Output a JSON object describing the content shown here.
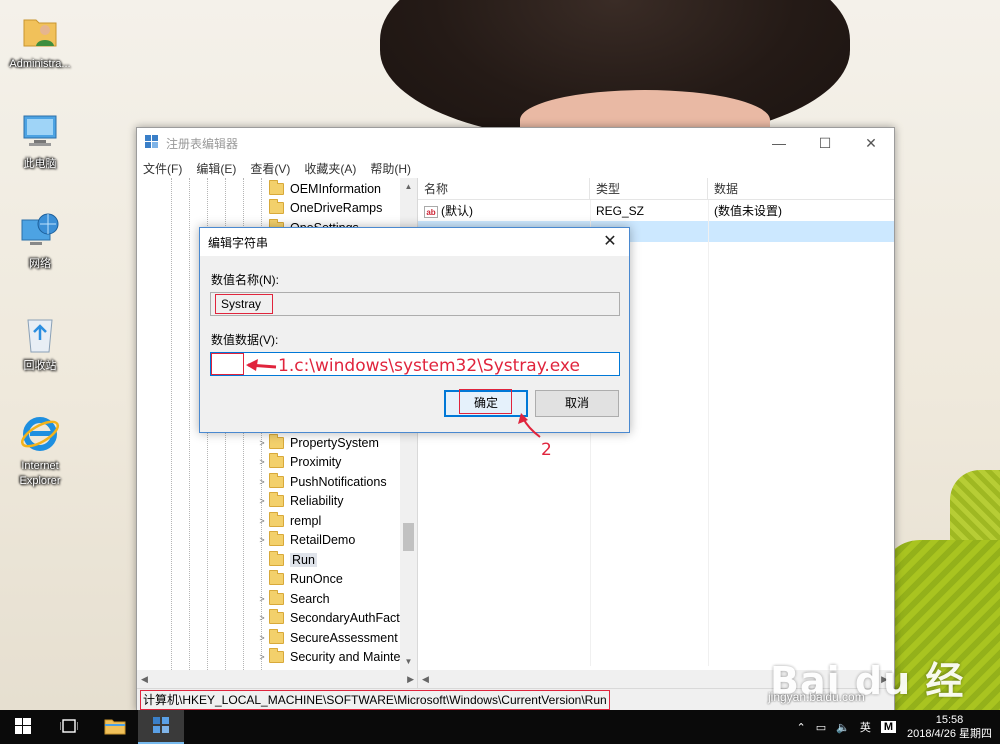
{
  "desktop": {
    "icons": [
      {
        "label": "Administra...",
        "icon": "user-folder-icon"
      },
      {
        "label": "此电脑",
        "icon": "this-pc-icon"
      },
      {
        "label": "网络",
        "icon": "network-icon"
      },
      {
        "label": "回收站",
        "icon": "recycle-bin-icon"
      },
      {
        "label": "Internet Explorer",
        "icon": "internet-explorer-icon"
      }
    ]
  },
  "regedit": {
    "title": "注册表编辑器",
    "menu": [
      "文件(F)",
      "编辑(E)",
      "查看(V)",
      "收藏夹(A)",
      "帮助(H)"
    ],
    "tree_top": [
      {
        "label": "OEMInformation",
        "expandable": false
      },
      {
        "label": "OneDriveRamps",
        "expandable": false
      },
      {
        "label": "OneSettings",
        "expandable": false
      }
    ],
    "tree_bottom": [
      {
        "label": "PropertySystem",
        "expandable": true
      },
      {
        "label": "Proximity",
        "expandable": true
      },
      {
        "label": "PushNotifications",
        "expandable": true
      },
      {
        "label": "Reliability",
        "expandable": true
      },
      {
        "label": "rempl",
        "expandable": true
      },
      {
        "label": "RetailDemo",
        "expandable": true
      },
      {
        "label": "Run",
        "expandable": false,
        "selected": true
      },
      {
        "label": "RunOnce",
        "expandable": false
      },
      {
        "label": "Search",
        "expandable": true
      },
      {
        "label": "SecondaryAuthFact",
        "expandable": true
      },
      {
        "label": "SecureAssessment",
        "expandable": true
      },
      {
        "label": "Security and Mainte",
        "expandable": true
      }
    ],
    "columns": [
      "名称",
      "类型",
      "数据"
    ],
    "rows": [
      {
        "name": "(默认)",
        "type": "REG_SZ",
        "data": "(数值未设置)",
        "selected": false
      },
      {
        "name": "",
        "type": "SZ",
        "data": "",
        "selected": true
      }
    ],
    "status_path": "计算机\\HKEY_LOCAL_MACHINE\\SOFTWARE\\Microsoft\\Windows\\CurrentVersion\\Run"
  },
  "dialog": {
    "title": "编辑字符串",
    "name_label": "数值名称(N):",
    "name_value": "Systray",
    "data_label": "数值数据(V):",
    "data_value": "",
    "ok_label": "确定",
    "cancel_label": "取消",
    "close_glyph": "✕"
  },
  "annotations": {
    "step1": "1.c:\\windows\\system32\\Systray.exe",
    "step2": "2",
    "color": "#e0243c"
  },
  "taskbar": {
    "time": "15:58",
    "date": "2018/4/26 星期四",
    "ime": "英",
    "ime_mode": "M"
  },
  "watermark": {
    "brand": "Bai du 经验",
    "site": "jingyan.baidu.com"
  }
}
